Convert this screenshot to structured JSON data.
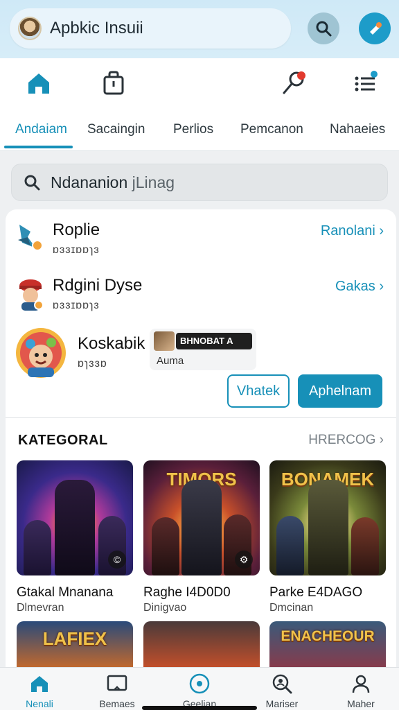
{
  "account": {
    "name": "Apbkic Insuii",
    "avatar_icon": "user-avatar-icon"
  },
  "top_actions": [
    {
      "icon": "search-icon"
    },
    {
      "icon": "brand-icon"
    }
  ],
  "nav_icons": [
    "home-icon",
    "bag-icon",
    "pin-icon",
    "menu-list-icon"
  ],
  "tabs": [
    {
      "label": "Andaiam",
      "active": true
    },
    {
      "label": "Sacaingin"
    },
    {
      "label": "Perlios"
    },
    {
      "label": "Pemcanon"
    },
    {
      "label": "Nahaeies"
    }
  ],
  "search": {
    "value": "Ndananion",
    "placeholder": "jLinag"
  },
  "rows": [
    {
      "title": "Roplie",
      "sub": "ɒɜɜɪɒɒɿɜ",
      "link": "Ranolani"
    },
    {
      "title": "Rdgini Dyse",
      "sub": "ɒɜɜɪɒɒɿɜ",
      "link": "Gakas"
    },
    {
      "title": "Koskabik",
      "sub": "ɒɿɜɜɒ",
      "tag": "BHNOBAT A",
      "tag_sub": "Auma"
    }
  ],
  "buttons": {
    "outline": "Vhatek",
    "fill": "Aphelnam"
  },
  "category": {
    "title": "KATEGORAL",
    "more": "HRERCOG"
  },
  "games": [
    {
      "name": "Gtakal Mnanana",
      "genre": "Dlmevran",
      "logo": ""
    },
    {
      "name": "Raghe I4D0D0",
      "genre": "Dinigvao",
      "logo": "TIMORS"
    },
    {
      "name": "Parke E4DAGO",
      "genre": "Dmcinan",
      "logo": "BONAMEK"
    }
  ],
  "games_row2": [
    {
      "logo": "LAFIEX"
    },
    {
      "logo": ""
    },
    {
      "logo": "ENACHEOUR"
    }
  ],
  "bottom_nav": [
    {
      "label": "Nenali",
      "icon": "home-icon",
      "active": true
    },
    {
      "label": "Bemaes",
      "icon": "screen-icon"
    },
    {
      "label": "Geelian",
      "icon": "play-circle-icon"
    },
    {
      "label": "Mariser",
      "icon": "search-people-icon"
    },
    {
      "label": "Maher",
      "icon": "profile-icon"
    }
  ],
  "colors": {
    "accent": "#1790b8",
    "topbar": "#cfe9f7",
    "background": "#eef0f2"
  }
}
